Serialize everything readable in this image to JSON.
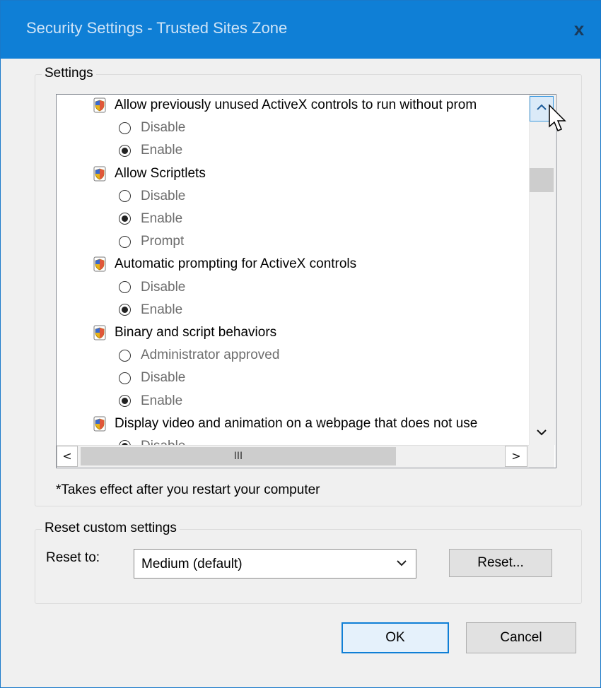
{
  "window": {
    "title": "Security Settings - Trusted Sites Zone",
    "close_glyph": "x"
  },
  "settings_group": {
    "label": "Settings"
  },
  "settings_list": [
    {
      "type": "setting",
      "label": "Allow previously unused ActiveX controls to run without prom"
    },
    {
      "type": "option",
      "label": "Disable",
      "selected": false
    },
    {
      "type": "option",
      "label": "Enable",
      "selected": true
    },
    {
      "type": "setting",
      "label": "Allow Scriptlets"
    },
    {
      "type": "option",
      "label": "Disable",
      "selected": false
    },
    {
      "type": "option",
      "label": "Enable",
      "selected": true
    },
    {
      "type": "option",
      "label": "Prompt",
      "selected": false
    },
    {
      "type": "setting",
      "label": "Automatic prompting for ActiveX controls"
    },
    {
      "type": "option",
      "label": "Disable",
      "selected": false
    },
    {
      "type": "option",
      "label": "Enable",
      "selected": true
    },
    {
      "type": "setting",
      "label": "Binary and script behaviors"
    },
    {
      "type": "option",
      "label": "Administrator approved",
      "selected": false
    },
    {
      "type": "option",
      "label": "Disable",
      "selected": false
    },
    {
      "type": "option",
      "label": "Enable",
      "selected": true
    },
    {
      "type": "setting",
      "label": "Display video and animation on a webpage that does not use"
    },
    {
      "type": "option",
      "label": "Disable",
      "selected": true
    }
  ],
  "scrollbars": {
    "up": "^",
    "down": "v",
    "left": "<",
    "right": ">",
    "grip": "III"
  },
  "note": "*Takes effect after you restart your computer",
  "reset_group": {
    "label": "Reset custom settings",
    "reset_to_label": "Reset to:",
    "selected_level": "Medium (default)",
    "reset_button": "Reset..."
  },
  "buttons": {
    "ok": "OK",
    "cancel": "Cancel"
  }
}
